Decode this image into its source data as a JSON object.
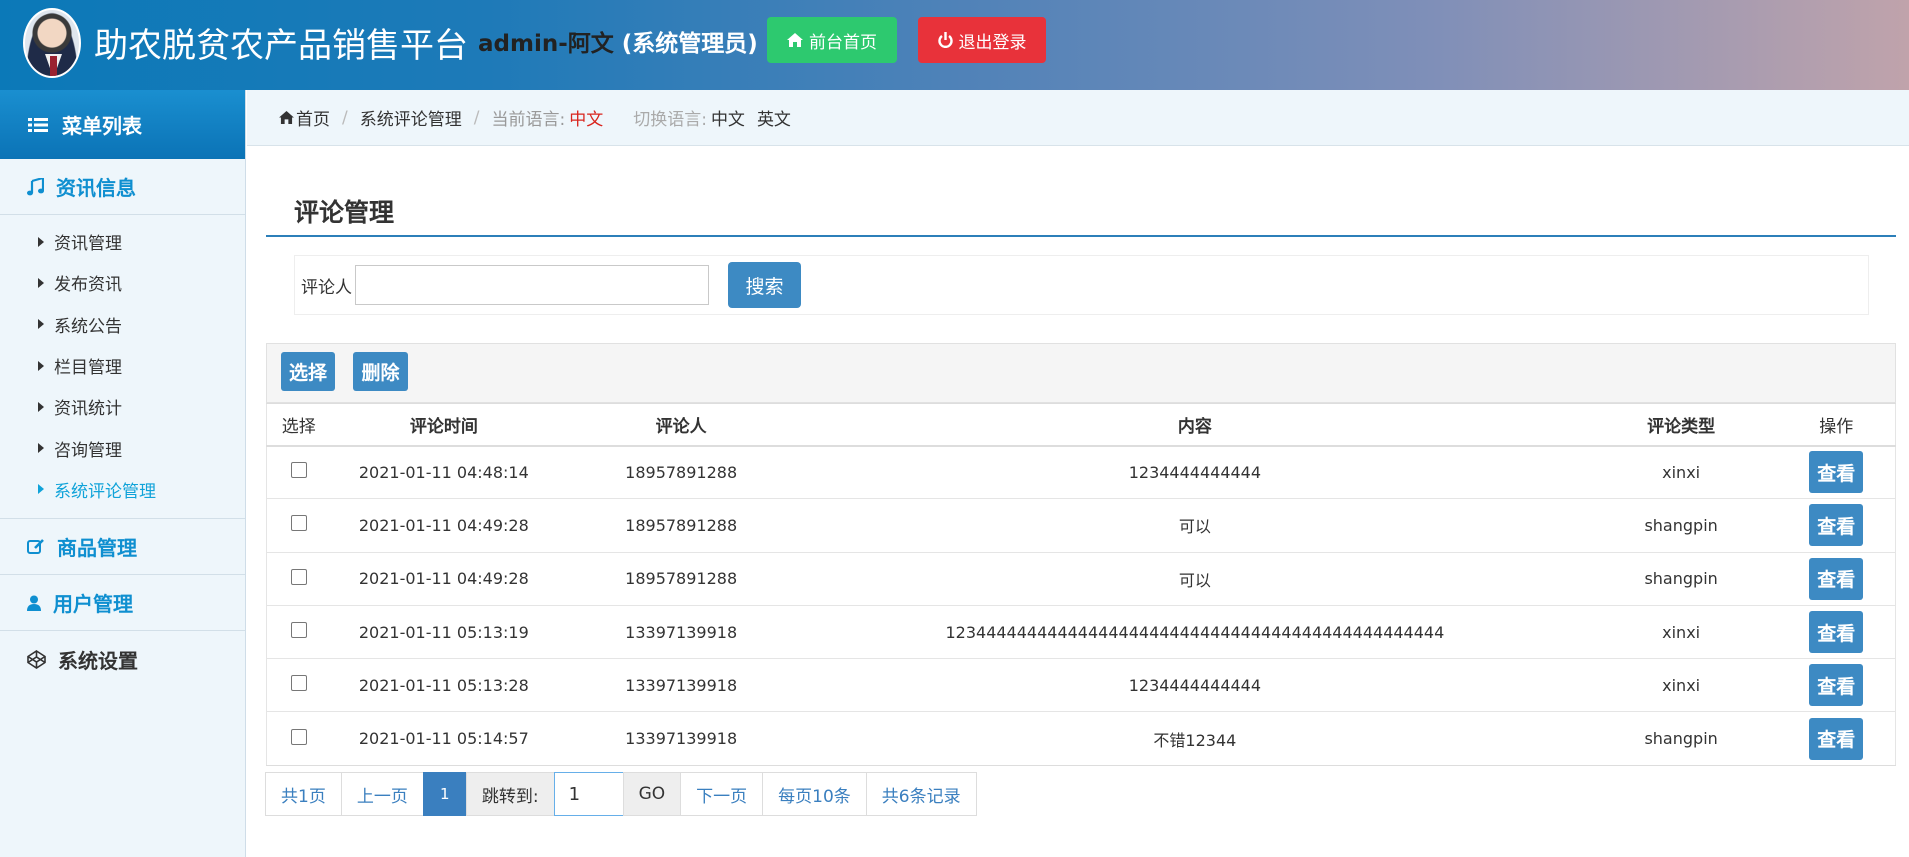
{
  "header": {
    "site_title": "助农脱贫农产品销售平台",
    "admin_name": "admin-阿文",
    "admin_role": "(系统管理员)",
    "home_label": "前台首页",
    "logout_label": "退出登录",
    "home_color": "#2dc96f",
    "logout_color": "#e8323a"
  },
  "sidebar": {
    "menu_title": "菜单列表",
    "section_info": "资讯信息",
    "items": [
      {
        "label": "资讯管理"
      },
      {
        "label": "发布资讯"
      },
      {
        "label": "系统公告"
      },
      {
        "label": "栏目管理"
      },
      {
        "label": "资讯统计"
      },
      {
        "label": "咨询管理"
      },
      {
        "label": "系统评论管理",
        "active": true
      }
    ],
    "section_goods": "商品管理",
    "section_users": "用户管理",
    "section_settings": "系统设置"
  },
  "breadcrumb": {
    "home": "首页",
    "current": "系统评论管理",
    "lang_label": "当前语言:",
    "lang_value": "中文",
    "switch_label": "切换语言:",
    "lang_zh": "中文",
    "lang_en": "英文"
  },
  "main": {
    "title": "评论管理",
    "search_label": "评论人",
    "search_value": "",
    "search_button": "搜索",
    "select_button": "选择",
    "delete_button": "删除"
  },
  "table": {
    "headers": [
      "选择",
      "评论时间",
      "评论人",
      "内容",
      "评论类型",
      "操作"
    ],
    "view_label": "查看",
    "rows": [
      {
        "time": "2021-01-11 04:48:14",
        "user": "18957891288",
        "content": "1234444444444",
        "type": "xinxi"
      },
      {
        "time": "2021-01-11 04:49:28",
        "user": "18957891288",
        "content": "可以",
        "type": "shangpin"
      },
      {
        "time": "2021-01-11 04:49:28",
        "user": "18957891288",
        "content": "可以",
        "type": "shangpin"
      },
      {
        "time": "2021-01-11 05:13:19",
        "user": "13397139918",
        "content": "1234444444444444444444444444444444444444444444444",
        "type": "xinxi"
      },
      {
        "time": "2021-01-11 05:13:28",
        "user": "13397139918",
        "content": "1234444444444",
        "type": "xinxi"
      },
      {
        "time": "2021-01-11 05:14:57",
        "user": "13397139918",
        "content": "不错12344",
        "type": "shangpin"
      }
    ]
  },
  "pager": {
    "total_pages": "共1页",
    "prev": "上一页",
    "current": "1",
    "jump_label": "跳转到:",
    "jump_value": "1",
    "go": "GO",
    "next": "下一页",
    "per_page": "每页10条",
    "total_records": "共6条记录"
  }
}
